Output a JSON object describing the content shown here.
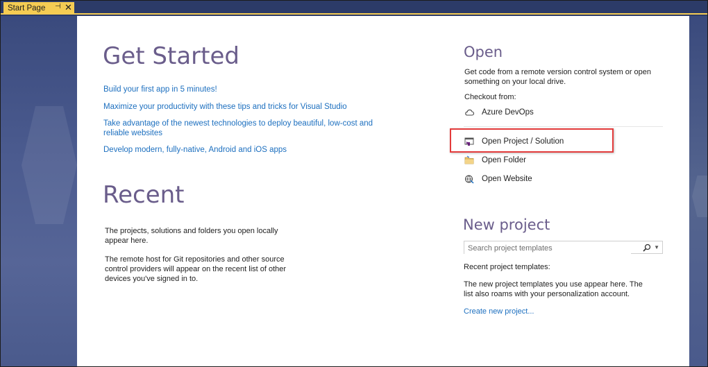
{
  "tab": {
    "label": "Start Page",
    "pin_icon": "pin-icon",
    "close_icon": "close-icon"
  },
  "get_started": {
    "title": "Get Started",
    "links": [
      "Build your first app in 5 minutes!",
      "Maximize your productivity with these tips and tricks for Visual Studio",
      "Take advantage of the newest technologies to deploy beautiful, low-cost and",
      "reliable websites",
      "Develop modern, fully-native, Android and iOS apps"
    ]
  },
  "recent": {
    "title": "Recent",
    "paragraph1": [
      "The projects, solutions and folders you open locally",
      "appear here."
    ],
    "paragraph2": [
      "The remote host for Git repositories and other source",
      "control providers will appear on the recent list of other",
      "devices you've signed in to."
    ]
  },
  "open": {
    "title": "Open",
    "description": [
      "Get code from a remote version control system or open",
      "something on your local drive."
    ],
    "checkout_label": "Checkout from:",
    "azure_devops": "Azure DevOps",
    "open_project_solution": "Open Project / Solution",
    "open_folder": "Open Folder",
    "open_website": "Open Website"
  },
  "new_project": {
    "title": "New project",
    "search_placeholder": "Search project templates",
    "recent_templates_label": "Recent project templates:",
    "templates_note": [
      "The new project templates you use appear here. The",
      "list also roams with your personalization account."
    ],
    "create_link": "Create new project..."
  },
  "colors": {
    "accent_tab": "#f5cc53",
    "heading": "#6a5d8b",
    "link": "#1c6fbf",
    "highlight_border": "#e33b3b",
    "background_frame": "#2b3a67"
  }
}
